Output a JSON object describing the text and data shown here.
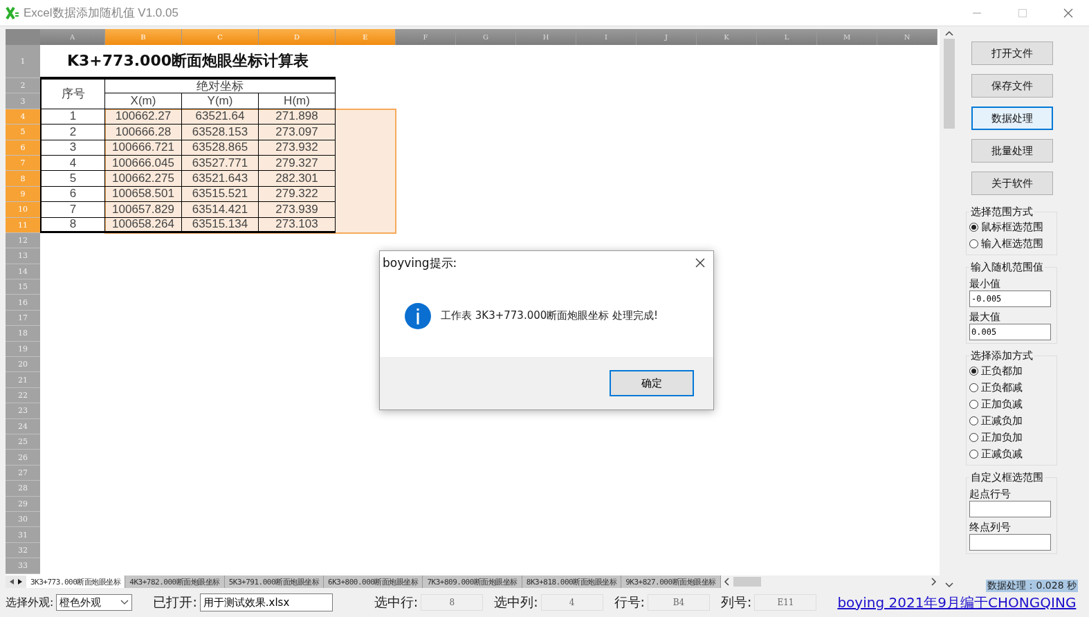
{
  "window": {
    "title": "Excel数据添加随机值 V1.0.05"
  },
  "sheet": {
    "columns": [
      {
        "label": "A",
        "selected": false
      },
      {
        "label": "B",
        "selected": true
      },
      {
        "label": "C",
        "selected": true
      },
      {
        "label": "D",
        "selected": true
      },
      {
        "label": "E",
        "selected": true
      },
      {
        "label": "F",
        "selected": false
      },
      {
        "label": "G",
        "selected": false
      },
      {
        "label": "H",
        "selected": false
      },
      {
        "label": "I",
        "selected": false
      },
      {
        "label": "J",
        "selected": false
      },
      {
        "label": "K",
        "selected": false
      },
      {
        "label": "L",
        "selected": false
      },
      {
        "label": "M",
        "selected": false
      },
      {
        "label": "N",
        "selected": false
      }
    ],
    "rows": [
      {
        "label": "1",
        "selected": false
      },
      {
        "label": "2",
        "selected": false
      },
      {
        "label": "3",
        "selected": false
      },
      {
        "label": "4",
        "selected": true
      },
      {
        "label": "5",
        "selected": true
      },
      {
        "label": "6",
        "selected": true
      },
      {
        "label": "7",
        "selected": true
      },
      {
        "label": "8",
        "selected": true
      },
      {
        "label": "9",
        "selected": true
      },
      {
        "label": "10",
        "selected": true
      },
      {
        "label": "11",
        "selected": true
      },
      {
        "label": "12",
        "selected": false
      },
      {
        "label": "13",
        "selected": false
      },
      {
        "label": "14",
        "selected": false
      },
      {
        "label": "15",
        "selected": false
      },
      {
        "label": "16",
        "selected": false
      },
      {
        "label": "17",
        "selected": false
      },
      {
        "label": "18",
        "selected": false
      },
      {
        "label": "19",
        "selected": false
      },
      {
        "label": "20",
        "selected": false
      },
      {
        "label": "21",
        "selected": false
      },
      {
        "label": "22",
        "selected": false
      },
      {
        "label": "23",
        "selected": false
      },
      {
        "label": "24",
        "selected": false
      },
      {
        "label": "25",
        "selected": false
      },
      {
        "label": "26",
        "selected": false
      },
      {
        "label": "27",
        "selected": false
      },
      {
        "label": "28",
        "selected": false
      },
      {
        "label": "29",
        "selected": false
      },
      {
        "label": "30",
        "selected": false
      },
      {
        "label": "31",
        "selected": false
      },
      {
        "label": "32",
        "selected": false
      },
      {
        "label": "33",
        "selected": false
      }
    ],
    "title": "K3+773.000断面炮眼坐标计算表",
    "index_header": "序号",
    "group_header": "绝对坐标",
    "table_columns": [
      "X(m)",
      "Y(m)",
      "H(m)"
    ],
    "table_rows": [
      [
        "1",
        "100662.27",
        "63521.64",
        "271.898"
      ],
      [
        "2",
        "100666.28",
        "63528.153",
        "273.097"
      ],
      [
        "3",
        "100666.721",
        "63528.865",
        "273.932"
      ],
      [
        "4",
        "100666.045",
        "63527.771",
        "279.327"
      ],
      [
        "5",
        "100662.275",
        "63521.643",
        "282.301"
      ],
      [
        "6",
        "100658.501",
        "63515.521",
        "279.322"
      ],
      [
        "7",
        "100657.829",
        "63514.421",
        "273.939"
      ],
      [
        "8",
        "100658.264",
        "63515.134",
        "273.103"
      ]
    ]
  },
  "sheet_tabs": [
    {
      "label": "3K3+773.000断面炮眼坐标",
      "selected": true
    },
    {
      "label": "4K3+782.000断面炮眼坐标",
      "selected": false
    },
    {
      "label": "5K3+791.000断面炮眼坐标",
      "selected": false
    },
    {
      "label": "6K3+800.000断面炮眼坐标",
      "selected": false
    },
    {
      "label": "7K3+809.000断面炮眼坐标",
      "selected": false
    },
    {
      "label": "8K3+818.000断面炮眼坐标",
      "selected": false
    },
    {
      "label": "9K3+827.000断面炮眼坐标",
      "selected": false
    }
  ],
  "side_buttons": [
    {
      "label": "打开文件",
      "selected": false
    },
    {
      "label": "保存文件",
      "selected": false
    },
    {
      "label": "数据处理",
      "selected": true
    },
    {
      "label": "批量处理",
      "selected": false
    },
    {
      "label": "关于软件",
      "selected": false
    }
  ],
  "range_mode": {
    "title": "选择范围方式",
    "options": [
      {
        "label": "鼠标框选范围",
        "selected": true
      },
      {
        "label": "输入框选范围",
        "selected": false
      }
    ]
  },
  "random_range": {
    "title": "输入随机范围值",
    "fields": [
      {
        "label": "最小值",
        "value": "-0.005"
      },
      {
        "label": "最大值",
        "value": "0.005"
      }
    ]
  },
  "add_mode": {
    "title": "选择添加方式",
    "options": [
      {
        "label": "正负都加",
        "selected": true
      },
      {
        "label": "正负都减",
        "selected": false
      },
      {
        "label": "正加负减",
        "selected": false
      },
      {
        "label": "正减负加",
        "selected": false
      },
      {
        "label": "正加负加",
        "selected": false
      },
      {
        "label": "正减负减",
        "selected": false
      }
    ]
  },
  "custom_range": {
    "title": "自定义框选范围",
    "fields": [
      {
        "label": "起点行号"
      },
      {
        "label": "终点列号"
      }
    ]
  },
  "timing": "数据处理：0.028 秒",
  "status_bar": {
    "skin_label": "选择外观:",
    "skin_value": "橙色外观",
    "opened_label": "已打开:",
    "opened_value": "用于测试效果.xlsx",
    "readouts": [
      {
        "label": "选中行:",
        "value": "8"
      },
      {
        "label": "选中列:",
        "value": "4"
      },
      {
        "label": "行号:",
        "value": "B4"
      },
      {
        "label": "列号:",
        "value": "E11"
      }
    ],
    "link": "boying 2021年9月编于CHONGQING"
  },
  "dialog": {
    "title": "boyving提示:",
    "message": "工作表 3K3+773.000断面炮眼坐标 处理完成!",
    "button": "确定"
  }
}
